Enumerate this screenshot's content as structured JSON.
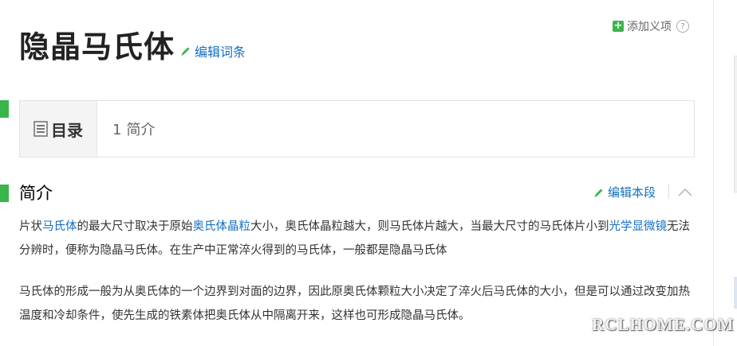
{
  "entry": {
    "title": "隐晶马氏体",
    "edit_entry_label": "编辑词条",
    "add_sense_label": "添加义项",
    "help_glyph": "?"
  },
  "toc": {
    "label": "目录",
    "items": [
      {
        "num": "1",
        "label": "简介"
      }
    ]
  },
  "section": {
    "title": "简介",
    "edit_label": "编辑本段"
  },
  "paragraphs": {
    "p1": {
      "t0": "片状",
      "link1": "马氏体",
      "t1": "的最大尺寸取决于原始",
      "link2": "奥氏体晶粒",
      "t2": "大小，奥氏体晶粒越大，则马氏体片越大，当最大尺寸的马氏体片小到",
      "link3": "光学显微镜",
      "t3": "无法分辨时，便称为隐晶马氏体。在生产中正常淬火得到的马氏体，一般都是隐晶马氏体"
    },
    "p2": "马氏体的形成一般为从奥氏体的一个边界到对面的边界，因此原奥氏体颗粒大小决定了淬火后马氏体的大小，但是可以通过改变加热温度和冷却条件，使先生成的铁素体把奥氏体从中隔离开来，这样也可形成隐晶马氏体。"
  },
  "watermark": "RCLHOME.COM",
  "colors": {
    "link": "#136ec2",
    "accent_green": "#39b54a"
  }
}
